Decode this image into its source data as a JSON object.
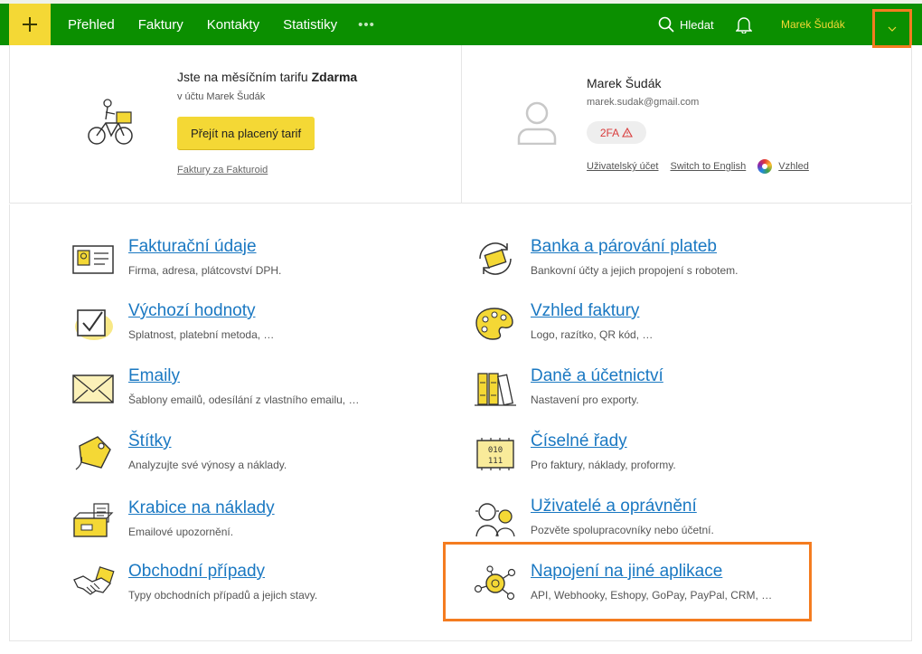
{
  "topbar": {
    "nav": [
      "Přehled",
      "Faktury",
      "Kontakty",
      "Statistiky"
    ],
    "more": "•••",
    "search_label": "Hledat",
    "user_name": "Marek Šudák",
    "accent_color": "#0b8f00",
    "highlight_color": "#f4d835"
  },
  "account": {
    "tariff_prefix": "Jste na měsíčním tarifu ",
    "tariff_name": "Zdarma",
    "owner": "v účtu Marek Šudák",
    "upgrade_button": "Přejít na placený tarif",
    "invoices_link": "Faktury za Fakturoid"
  },
  "profile": {
    "name": "Marek Šudák",
    "email": "marek.sudak@gmail.com",
    "twofa": "2FA",
    "user_account_link": "Uživatelský účet",
    "language_link": "Switch to English",
    "appearance_link": "Vzhled"
  },
  "settings": {
    "left": [
      {
        "title": "Fakturační údaje",
        "desc": "Firma, adresa, plátcovství DPH.",
        "icon": "id-card-icon"
      },
      {
        "title": "Výchozí hodnoty",
        "desc": "Splatnost, platební metoda, …",
        "icon": "checkbox-icon"
      },
      {
        "title": "Emaily",
        "desc": "Šablony emailů, odesílání z vlastního emailu, …",
        "icon": "envelope-icon"
      },
      {
        "title": "Štítky",
        "desc": "Analyzujte své výnosy a náklady.",
        "icon": "tag-icon"
      },
      {
        "title": "Krabice na náklady",
        "desc": "Emailové upozornění.",
        "icon": "box-icon"
      },
      {
        "title": "Obchodní případy",
        "desc": "Typy obchodních případů a jejich stavy.",
        "icon": "handshake-icon"
      }
    ],
    "right": [
      {
        "title": "Banka a párování plateb",
        "desc": "Bankovní účty a jejich propojení s robotem.",
        "icon": "bank-sync-icon"
      },
      {
        "title": "Vzhled faktury",
        "desc": "Logo, razítko, QR kód, …",
        "icon": "palette-icon"
      },
      {
        "title": "Daně a účetnictví",
        "desc": "Nastavení pro exporty.",
        "icon": "binders-icon"
      },
      {
        "title": "Číselné řady",
        "desc": "Pro faktury, náklady, proformy.",
        "icon": "number-series-icon"
      },
      {
        "title": "Uživatelé a oprávnění",
        "desc": "Pozvěte spolupracovníky nebo účetní.",
        "icon": "users-icon"
      },
      {
        "title": "Napojení na jiné aplikace",
        "desc": "API, Webhooky, Eshopy, GoPay, PayPal, CRM, …",
        "icon": "network-icon"
      }
    ]
  }
}
